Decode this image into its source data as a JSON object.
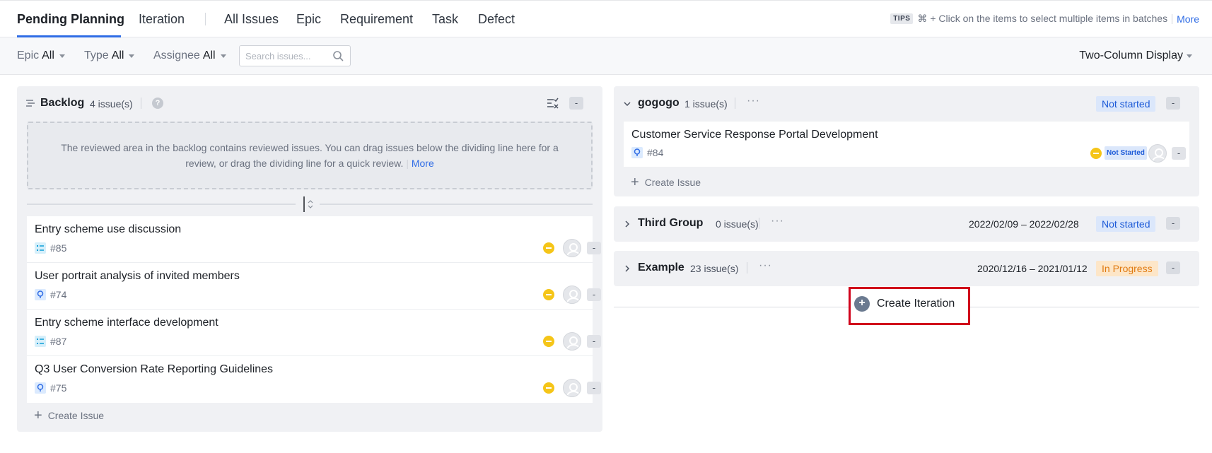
{
  "tabs": {
    "pending_planning": "Pending Planning",
    "iteration": "Iteration",
    "all_issues": "All Issues",
    "epic": "Epic",
    "requirement": "Requirement",
    "task": "Task",
    "defect": "Defect"
  },
  "tips": {
    "badge": "TIPS",
    "text": "⌘ + Click on the items to select multiple items in batches",
    "more": "More"
  },
  "filters": {
    "epic_label": "Epic",
    "epic_value": "All",
    "type_label": "Type",
    "type_value": "All",
    "assignee_label": "Assignee",
    "assignee_value": "All",
    "search_placeholder": "Search issues...",
    "display": "Two-Column Display"
  },
  "backlog": {
    "title": "Backlog",
    "count": "4 issue(s)",
    "help": "?",
    "menu": "-",
    "review_text": "The reviewed area in the backlog contains reviewed issues. You can drag issues below the dividing line here for a review, or drag the dividing line for a quick review.",
    "review_more": "More",
    "issues": [
      {
        "title": "Entry scheme use discussion",
        "id": "#85",
        "type_icon": "task-list-icon",
        "action": "-"
      },
      {
        "title": "User portrait analysis of invited members",
        "id": "#74",
        "type_icon": "requirement-bulb-icon",
        "action": "-"
      },
      {
        "title": "Entry scheme interface development",
        "id": "#87",
        "type_icon": "task-list-icon",
        "action": "-"
      },
      {
        "title": "Q3 User Conversion Rate Reporting Guidelines",
        "id": "#75",
        "type_icon": "requirement-bulb-icon",
        "action": "-"
      }
    ],
    "create_issue": "Create Issue"
  },
  "iterations": [
    {
      "name": "gogogo",
      "count": "1 issue(s)",
      "dates": "",
      "status": "Not started",
      "menu": "-",
      "expanded": true,
      "issue": {
        "title": "Customer Service Response Portal Development",
        "id": "#84",
        "status": "Not Started",
        "action": "-"
      },
      "create_issue": "Create Issue"
    },
    {
      "name": "Third Group",
      "count": "0 issue(s)",
      "dates": "2022/02/09 – 2022/02/28",
      "status": "Not started",
      "menu": "-",
      "expanded": false
    },
    {
      "name": "Example",
      "count": "23 issue(s)",
      "dates": "2020/12/16 – 2021/01/12",
      "status": "In Progress",
      "menu": "-",
      "expanded": false
    }
  ],
  "create_iteration": "Create Iteration",
  "more_dots": "···",
  "colors": {
    "accent": "#2f6ce5",
    "highlight": "#d0021b",
    "priority": "#f5c518",
    "not_started_bg": "#dbe7fb",
    "in_progress_bg": "#fde6c8"
  }
}
